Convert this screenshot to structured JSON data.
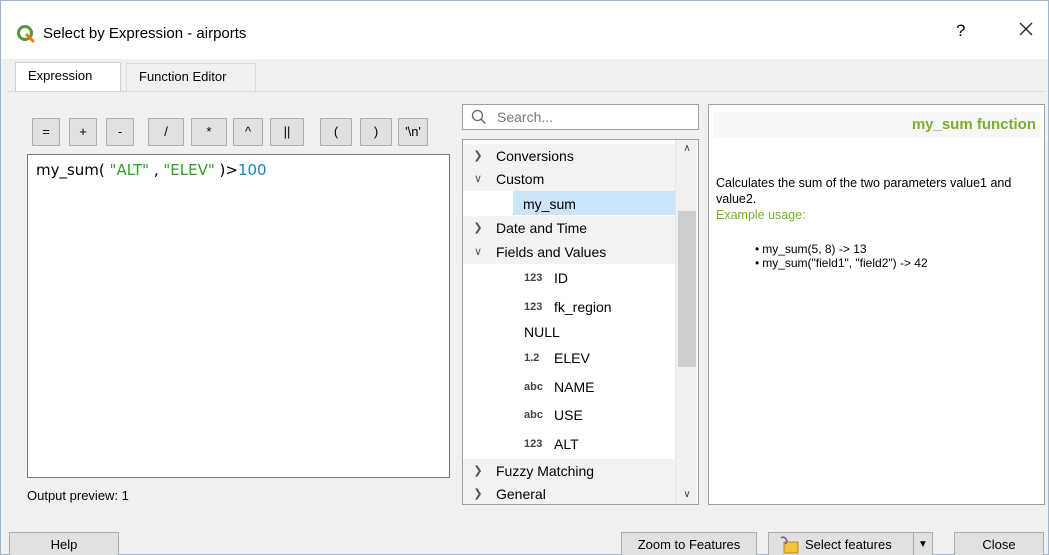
{
  "window": {
    "title": "Select by Expression - airports",
    "help_glyph": "?",
    "close_glyph": "✕"
  },
  "tabs": [
    {
      "label": "Expression",
      "active": true
    },
    {
      "label": "Function Editor",
      "active": false
    }
  ],
  "operators": [
    "=",
    "+",
    "-",
    "/",
    "*",
    "^",
    "||",
    "(",
    ")",
    "'\\n'"
  ],
  "editor": {
    "tokens": {
      "fn": "my_sum(",
      "arg1": " \"ALT\"",
      "sep": " ,",
      "arg2": " \"ELEV\"",
      "close": " )>",
      "num": "100"
    }
  },
  "output_preview": {
    "label": "Output preview:",
    "value": "1"
  },
  "search": {
    "placeholder": "Search..."
  },
  "tree": {
    "items": [
      {
        "label": "Conversions",
        "kind": "group",
        "expanded": false
      },
      {
        "label": "Custom",
        "kind": "group",
        "expanded": true
      },
      {
        "label": "my_sum",
        "kind": "item",
        "selected": true
      },
      {
        "label": "Date and Time",
        "kind": "group",
        "expanded": false
      },
      {
        "label": "Fields and Values",
        "kind": "group",
        "expanded": true
      },
      {
        "label": "ID",
        "kind": "field",
        "type": "123"
      },
      {
        "label": "fk_region",
        "kind": "field",
        "type": "123"
      },
      {
        "label": "NULL",
        "kind": "item"
      },
      {
        "label": "ELEV",
        "kind": "field",
        "type": "1.2"
      },
      {
        "label": "NAME",
        "kind": "field",
        "type": "abc"
      },
      {
        "label": "USE",
        "kind": "field",
        "type": "abc"
      },
      {
        "label": "ALT",
        "kind": "field",
        "type": "123"
      },
      {
        "label": "Fuzzy Matching",
        "kind": "group",
        "expanded": false
      },
      {
        "label": "General",
        "kind": "group",
        "expanded": false
      }
    ]
  },
  "help": {
    "heading": "my_sum function",
    "description": "Calculates the sum of the two parameters value1 and value2.",
    "example_label": "Example usage:",
    "examples": [
      "my_sum(5, 8) -> 13",
      "my_sum(\"field1\", \"field2\") -> 42"
    ],
    "accent_color": "#7bb02c"
  },
  "buttons": {
    "help": "Help",
    "zoom": "Zoom to Features",
    "select": "Select features",
    "close": "Close"
  },
  "icons": {
    "app": "qgis-logo-icon",
    "search": "search-icon",
    "select": "select-expression-icon"
  }
}
